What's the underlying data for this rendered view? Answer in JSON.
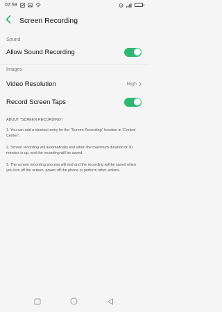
{
  "status_bar": {
    "time": "07:59",
    "icons": [
      "checkbox-icon",
      "image-icon",
      "wifi-icon",
      "alarm-icon",
      "signal-icon",
      "battery-icon"
    ],
    "battery_level": 0.8
  },
  "header": {
    "title": "Screen Recording",
    "back_icon": "chevron-left-icon",
    "accent": "#2eb872"
  },
  "sections": {
    "sound": {
      "label": "Sound",
      "allow_sound": {
        "label": "Allow Sound Recording",
        "on": true
      }
    },
    "images": {
      "label": "Images",
      "video_resolution": {
        "label": "Video Resolution",
        "value": "High"
      },
      "record_taps": {
        "label": "Record Screen Taps",
        "on": true
      }
    }
  },
  "about": {
    "heading": "ABOUT \"SCREEN RECORDING\":",
    "items": [
      "1. You can add a shortcut entry for the \"Screen Recording\" function in \"Control Center\".",
      "2. Screen recording will automatically end when the maximum duration of 30 minutes is up, and the recording will be saved.",
      "3. The screen recording process will end and the recording will be saved when you turn off the screen, power off the phone or perform other actions."
    ]
  },
  "nav": {
    "icons": [
      "square-icon",
      "circle-icon",
      "triangle-back-icon"
    ]
  }
}
